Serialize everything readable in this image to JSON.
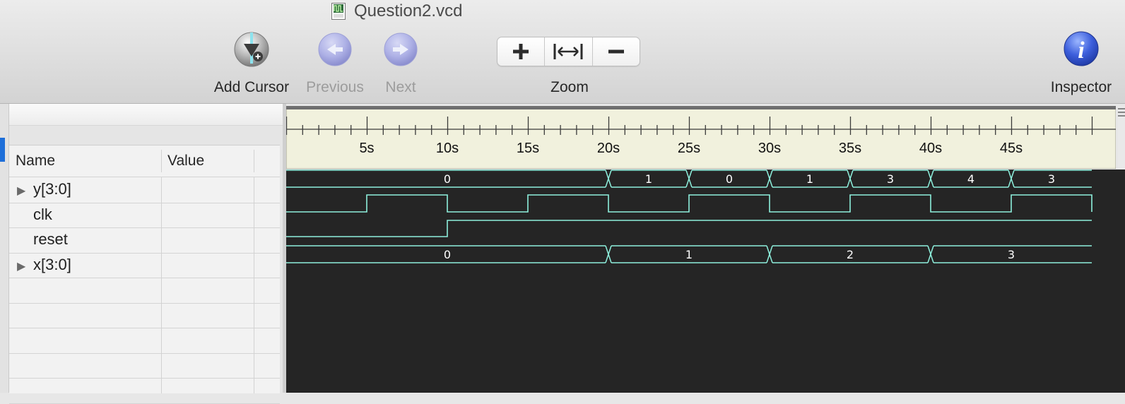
{
  "window": {
    "title": "Question2.vcd",
    "file_icon": "vcd-file-icon"
  },
  "toolbar": {
    "add_cursor": "Add Cursor",
    "previous": "Previous",
    "next": "Next",
    "zoom": "Zoom",
    "inspector": "Inspector"
  },
  "signals_table": {
    "headers": {
      "name": "Name",
      "value": "Value"
    },
    "rows": [
      {
        "name": "y[3:0]",
        "expandable": true,
        "value": ""
      },
      {
        "name": "clk",
        "expandable": false,
        "value": ""
      },
      {
        "name": "reset",
        "expandable": false,
        "value": ""
      },
      {
        "name": "x[3:0]",
        "expandable": true,
        "value": ""
      }
    ]
  },
  "ruler": {
    "unit": "s",
    "labels": [
      "5s",
      "10s",
      "15s",
      "20s",
      "25s",
      "30s",
      "35s",
      "40s",
      "45s"
    ],
    "range": [
      0,
      50
    ]
  },
  "waveforms": {
    "y": {
      "segments": [
        [
          0,
          20,
          "0"
        ],
        [
          20,
          25,
          "1"
        ],
        [
          25,
          30,
          "0"
        ],
        [
          30,
          35,
          "1"
        ],
        [
          35,
          40,
          "3"
        ],
        [
          40,
          45,
          "4"
        ],
        [
          45,
          50,
          "3"
        ]
      ]
    },
    "clk": {
      "edges": [
        [
          0,
          0
        ],
        [
          5,
          1
        ],
        [
          10,
          0
        ],
        [
          15,
          1
        ],
        [
          20,
          0
        ],
        [
          25,
          1
        ],
        [
          30,
          0
        ],
        [
          35,
          1
        ],
        [
          40,
          0
        ],
        [
          45,
          1
        ],
        [
          50,
          0
        ]
      ]
    },
    "reset": {
      "edges": [
        [
          0,
          0
        ],
        [
          10,
          1
        ],
        [
          50,
          1
        ]
      ]
    },
    "x": {
      "segments": [
        [
          0,
          20,
          "0"
        ],
        [
          20,
          30,
          "1"
        ],
        [
          30,
          40,
          "2"
        ],
        [
          40,
          50,
          "3"
        ]
      ]
    }
  },
  "colors": {
    "wave": "#8ef0dd",
    "wave_bg": "#252525",
    "ruler_bg": "#f1f1dd",
    "accent": "#1e6fd9"
  }
}
